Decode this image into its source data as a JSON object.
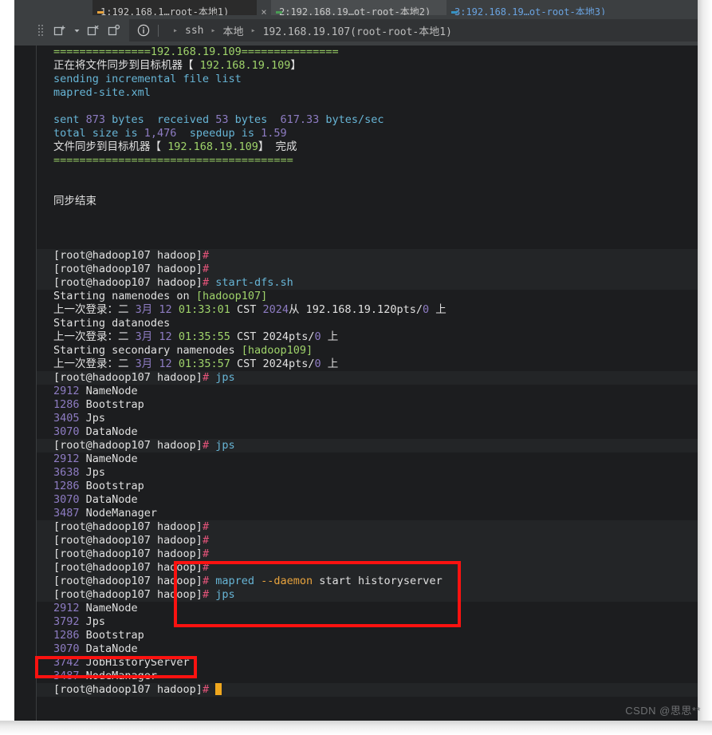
{
  "window": {
    "tabs": [
      {
        "label": "1:192.168.1…root-本地1)",
        "state": "inactive",
        "dot_color": "#e8a33d",
        "close_label": "×"
      },
      {
        "label": "2:192.168.19…ot-root-本地2)",
        "state": "active",
        "dot_color": "#499c54",
        "close_label": ""
      },
      {
        "label": "3:192.168.19…ot-root-本地3)",
        "state": "inactive",
        "dot_color": "#3592c4",
        "close_label": ""
      }
    ]
  },
  "toolbar": {
    "grip_name": "drag-handle",
    "new_session_label": "＋",
    "dropdown_caret": "▾",
    "close_session_label": "×",
    "duplicate_session_label": "○",
    "info_label": "i",
    "breadcrumb": {
      "items": [
        "ssh",
        "本地",
        "192.168.19.107(root-root-本地1)"
      ],
      "separator": "▸"
    }
  },
  "terminal": {
    "lines": [
      {
        "id": "l1",
        "type": "out",
        "segs": [
          {
            "t": "===============",
            "c": "c-green"
          },
          {
            "t": "192.168.19.109",
            "c": "c-ltgreen"
          },
          {
            "t": "===============",
            "c": "c-green"
          }
        ]
      },
      {
        "id": "l2",
        "type": "out",
        "segs": [
          {
            "t": "正在将文件同步到目标机器【",
            "c": "c-white"
          },
          {
            "t": " 192.168.19.109",
            "c": "c-ltgreen"
          },
          {
            "t": "】",
            "c": "c-white"
          }
        ]
      },
      {
        "id": "l3",
        "type": "out",
        "segs": [
          {
            "t": "sending incremental file list",
            "c": "c-cyan"
          }
        ]
      },
      {
        "id": "l4",
        "type": "out",
        "segs": [
          {
            "t": "mapred-site.xml",
            "c": "c-cyan"
          }
        ]
      },
      {
        "id": "l5",
        "type": "out",
        "segs": [
          {
            "t": "",
            "c": "c-white"
          }
        ]
      },
      {
        "id": "l6",
        "type": "out",
        "segs": [
          {
            "t": "sent ",
            "c": "c-cyan"
          },
          {
            "t": "873",
            "c": "c-purple"
          },
          {
            "t": " bytes  received ",
            "c": "c-cyan"
          },
          {
            "t": "53",
            "c": "c-purple"
          },
          {
            "t": " bytes  ",
            "c": "c-cyan"
          },
          {
            "t": "617.33",
            "c": "c-purple"
          },
          {
            "t": " bytes/sec",
            "c": "c-cyan"
          }
        ]
      },
      {
        "id": "l7",
        "type": "out",
        "segs": [
          {
            "t": "total size is ",
            "c": "c-cyan"
          },
          {
            "t": "1,476",
            "c": "c-purple"
          },
          {
            "t": "  speedup is ",
            "c": "c-cyan"
          },
          {
            "t": "1.59",
            "c": "c-purple"
          }
        ]
      },
      {
        "id": "l8",
        "type": "out",
        "segs": [
          {
            "t": "文件同步到目标机器【",
            "c": "c-white"
          },
          {
            "t": " 192.168.19.109",
            "c": "c-ltgreen"
          },
          {
            "t": "】 完成",
            "c": "c-white"
          }
        ]
      },
      {
        "id": "l9",
        "type": "out",
        "segs": [
          {
            "t": "=====================================",
            "c": "c-green"
          }
        ]
      },
      {
        "id": "l10",
        "type": "out",
        "segs": [
          {
            "t": "",
            "c": "c-white"
          }
        ]
      },
      {
        "id": "l11",
        "type": "out",
        "segs": [
          {
            "t": "",
            "c": "c-white"
          }
        ]
      },
      {
        "id": "l12",
        "type": "out",
        "segs": [
          {
            "t": "同步结束",
            "c": "c-white"
          }
        ]
      },
      {
        "id": "l13",
        "type": "out",
        "segs": [
          {
            "t": "",
            "c": "c-white"
          }
        ]
      },
      {
        "id": "l14",
        "type": "out",
        "segs": [
          {
            "t": "",
            "c": "c-white"
          }
        ]
      },
      {
        "id": "l15",
        "type": "out",
        "segs": [
          {
            "t": "",
            "c": "c-white"
          }
        ]
      },
      {
        "id": "l16",
        "type": "prompt",
        "segs": [
          {
            "t": "[root@hadoop107 hadoop]",
            "c": "c-white"
          },
          {
            "t": "#",
            "c": "c-pink"
          }
        ]
      },
      {
        "id": "l17",
        "type": "prompt",
        "segs": [
          {
            "t": "[root@hadoop107 hadoop]",
            "c": "c-white"
          },
          {
            "t": "#",
            "c": "c-pink"
          }
        ]
      },
      {
        "id": "l18",
        "type": "prompt",
        "segs": [
          {
            "t": "[root@hadoop107 hadoop]",
            "c": "c-white"
          },
          {
            "t": "#",
            "c": "c-pink"
          },
          {
            "t": " start-dfs.sh",
            "c": "c-cyan"
          }
        ]
      },
      {
        "id": "l19",
        "type": "out",
        "segs": [
          {
            "t": "Starting namenodes on ",
            "c": "c-white"
          },
          {
            "t": "[hadoop107]",
            "c": "c-ltgreen"
          }
        ]
      },
      {
        "id": "l20",
        "type": "out",
        "segs": [
          {
            "t": "上一次登录：二 ",
            "c": "c-white"
          },
          {
            "t": "3月",
            "c": "c-purple"
          },
          {
            "t": " ",
            "c": "c-white"
          },
          {
            "t": "12",
            "c": "c-purple"
          },
          {
            "t": " ",
            "c": "c-white"
          },
          {
            "t": "01:33:01",
            "c": "c-ltgreen"
          },
          {
            "t": " CST ",
            "c": "c-white"
          },
          {
            "t": "2024",
            "c": "c-purple"
          },
          {
            "t": "从 ",
            "c": "c-white"
          },
          {
            "t": "192.168.19.120",
            "c": "c-white"
          },
          {
            "t": "pts/",
            "c": "c-white"
          },
          {
            "t": "0",
            "c": "c-purple"
          },
          {
            "t": " 上",
            "c": "c-white"
          }
        ]
      },
      {
        "id": "l21",
        "type": "out",
        "segs": [
          {
            "t": "Starting datanodes",
            "c": "c-white"
          }
        ]
      },
      {
        "id": "l22",
        "type": "out",
        "segs": [
          {
            "t": "上一次登录：二 ",
            "c": "c-white"
          },
          {
            "t": "3月",
            "c": "c-purple"
          },
          {
            "t": " ",
            "c": "c-white"
          },
          {
            "t": "12",
            "c": "c-purple"
          },
          {
            "t": " ",
            "c": "c-white"
          },
          {
            "t": "01:35:55",
            "c": "c-ltgreen"
          },
          {
            "t": " CST ",
            "c": "c-white"
          },
          {
            "t": "2024",
            "c": "c-white"
          },
          {
            "t": "pts/",
            "c": "c-white"
          },
          {
            "t": "0",
            "c": "c-purple"
          },
          {
            "t": " 上",
            "c": "c-white"
          }
        ]
      },
      {
        "id": "l23",
        "type": "out",
        "segs": [
          {
            "t": "Starting secondary namenodes ",
            "c": "c-white"
          },
          {
            "t": "[hadoop109]",
            "c": "c-ltgreen"
          }
        ]
      },
      {
        "id": "l24",
        "type": "out",
        "segs": [
          {
            "t": "上一次登录：二 ",
            "c": "c-white"
          },
          {
            "t": "3月",
            "c": "c-purple"
          },
          {
            "t": " ",
            "c": "c-white"
          },
          {
            "t": "12",
            "c": "c-purple"
          },
          {
            "t": " ",
            "c": "c-white"
          },
          {
            "t": "01:35:57",
            "c": "c-ltgreen"
          },
          {
            "t": " CST ",
            "c": "c-white"
          },
          {
            "t": "2024",
            "c": "c-white"
          },
          {
            "t": "pts/",
            "c": "c-white"
          },
          {
            "t": "0",
            "c": "c-purple"
          },
          {
            "t": " 上",
            "c": "c-white"
          }
        ]
      },
      {
        "id": "l25",
        "type": "prompt",
        "segs": [
          {
            "t": "[root@hadoop107 hadoop]",
            "c": "c-white"
          },
          {
            "t": "#",
            "c": "c-pink"
          },
          {
            "t": " jps",
            "c": "c-cyan"
          }
        ]
      },
      {
        "id": "l26",
        "type": "out",
        "segs": [
          {
            "t": "2912",
            "c": "c-purple"
          },
          {
            "t": " NameNode",
            "c": "c-white"
          }
        ]
      },
      {
        "id": "l27",
        "type": "out",
        "segs": [
          {
            "t": "1286",
            "c": "c-purple"
          },
          {
            "t": " Bootstrap",
            "c": "c-white"
          }
        ]
      },
      {
        "id": "l28",
        "type": "out",
        "segs": [
          {
            "t": "3405",
            "c": "c-purple"
          },
          {
            "t": " Jps",
            "c": "c-white"
          }
        ]
      },
      {
        "id": "l29",
        "type": "out",
        "segs": [
          {
            "t": "3070",
            "c": "c-purple"
          },
          {
            "t": " DataNode",
            "c": "c-white"
          }
        ]
      },
      {
        "id": "l30",
        "type": "prompt",
        "segs": [
          {
            "t": "[root@hadoop107 hadoop]",
            "c": "c-white"
          },
          {
            "t": "#",
            "c": "c-pink"
          },
          {
            "t": " jps",
            "c": "c-cyan"
          }
        ]
      },
      {
        "id": "l31",
        "type": "out",
        "segs": [
          {
            "t": "2912",
            "c": "c-purple"
          },
          {
            "t": " NameNode",
            "c": "c-white"
          }
        ]
      },
      {
        "id": "l32",
        "type": "out",
        "segs": [
          {
            "t": "3638",
            "c": "c-purple"
          },
          {
            "t": " Jps",
            "c": "c-white"
          }
        ]
      },
      {
        "id": "l33",
        "type": "out",
        "segs": [
          {
            "t": "1286",
            "c": "c-purple"
          },
          {
            "t": " Bootstrap",
            "c": "c-white"
          }
        ]
      },
      {
        "id": "l34",
        "type": "out",
        "segs": [
          {
            "t": "3070",
            "c": "c-purple"
          },
          {
            "t": " DataNode",
            "c": "c-white"
          }
        ]
      },
      {
        "id": "l35",
        "type": "out",
        "segs": [
          {
            "t": "3487",
            "c": "c-purple"
          },
          {
            "t": " NodeManager",
            "c": "c-white"
          }
        ]
      },
      {
        "id": "l36",
        "type": "prompt",
        "segs": [
          {
            "t": "[root@hadoop107 hadoop]",
            "c": "c-white"
          },
          {
            "t": "#",
            "c": "c-pink"
          }
        ]
      },
      {
        "id": "l37",
        "type": "prompt",
        "segs": [
          {
            "t": "[root@hadoop107 hadoop]",
            "c": "c-white"
          },
          {
            "t": "#",
            "c": "c-pink"
          }
        ]
      },
      {
        "id": "l38",
        "type": "prompt",
        "segs": [
          {
            "t": "[root@hadoop107 hadoop]",
            "c": "c-white"
          },
          {
            "t": "#",
            "c": "c-pink"
          }
        ]
      },
      {
        "id": "l39",
        "type": "prompt",
        "segs": [
          {
            "t": "[root@hadoop107 hadoop]",
            "c": "c-white"
          },
          {
            "t": "#",
            "c": "c-pink"
          }
        ]
      },
      {
        "id": "l40",
        "type": "prompt",
        "segs": [
          {
            "t": "[root@hadoop107 hadoop]",
            "c": "c-white"
          },
          {
            "t": "#",
            "c": "c-pink"
          },
          {
            "t": " mapred",
            "c": "c-cyan"
          },
          {
            "t": " --daemon",
            "c": "c-orange"
          },
          {
            "t": " start historyserver",
            "c": "c-white"
          }
        ]
      },
      {
        "id": "l41",
        "type": "prompt",
        "segs": [
          {
            "t": "[root@hadoop107 hadoop]",
            "c": "c-white"
          },
          {
            "t": "#",
            "c": "c-pink"
          },
          {
            "t": " jps",
            "c": "c-cyan"
          }
        ]
      },
      {
        "id": "l42",
        "type": "out",
        "segs": [
          {
            "t": "2912",
            "c": "c-purple"
          },
          {
            "t": " NameNode",
            "c": "c-white"
          }
        ]
      },
      {
        "id": "l43",
        "type": "out",
        "segs": [
          {
            "t": "3792",
            "c": "c-purple"
          },
          {
            "t": " Jps",
            "c": "c-white"
          }
        ]
      },
      {
        "id": "l44",
        "type": "out",
        "segs": [
          {
            "t": "1286",
            "c": "c-purple"
          },
          {
            "t": " Bootstrap",
            "c": "c-white"
          }
        ]
      },
      {
        "id": "l45",
        "type": "out",
        "segs": [
          {
            "t": "3070",
            "c": "c-purple"
          },
          {
            "t": " DataNode",
            "c": "c-white"
          }
        ]
      },
      {
        "id": "l46",
        "type": "out",
        "segs": [
          {
            "t": "3742",
            "c": "c-purple"
          },
          {
            "t": " JobHistoryServer",
            "c": "c-white"
          }
        ]
      },
      {
        "id": "l47",
        "type": "out",
        "segs": [
          {
            "t": "3487",
            "c": "c-purple"
          },
          {
            "t": " NodeManager",
            "c": "c-white"
          }
        ]
      },
      {
        "id": "l48",
        "type": "prompt",
        "cursor": true,
        "segs": [
          {
            "t": "[root@hadoop107 hadoop]",
            "c": "c-white"
          },
          {
            "t": "#",
            "c": "c-pink"
          },
          {
            "t": " ",
            "c": "c-white"
          }
        ]
      }
    ]
  },
  "annotations": [
    {
      "id": "annot-mapred",
      "name": "highlight-box-mapred-command",
      "color": "#fb1210"
    },
    {
      "id": "annot-jhs",
      "name": "highlight-box-jobhistoryserver",
      "color": "#fb1210"
    }
  ],
  "watermark": {
    "text": "CSDN @思思**"
  }
}
